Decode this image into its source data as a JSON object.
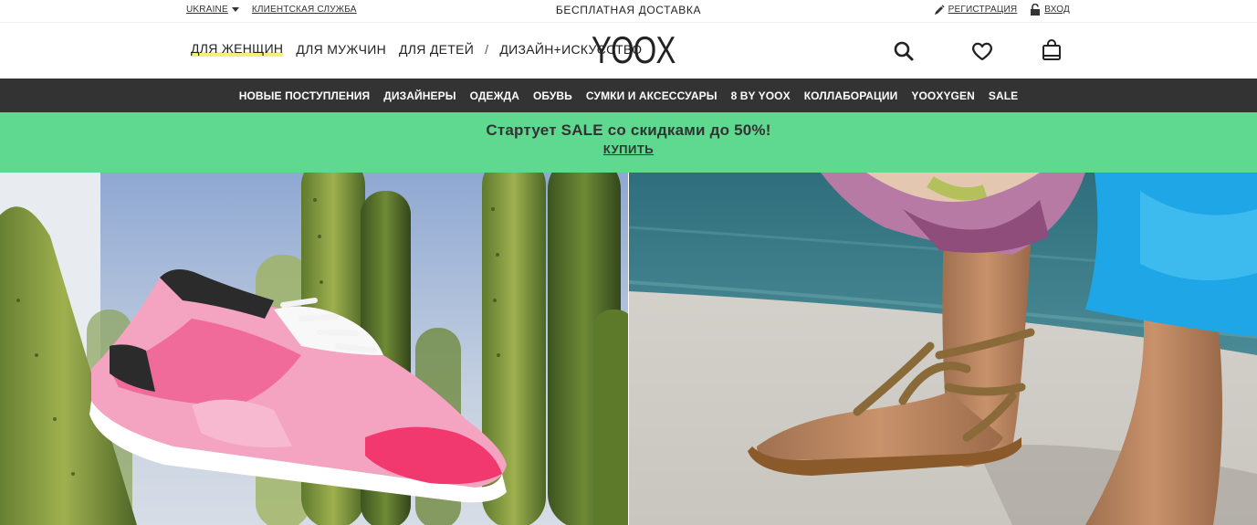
{
  "utility": {
    "country": "UKRAINE",
    "customer_service": "КЛИЕНТСКАЯ СЛУЖБА",
    "shipping": "БЕСПЛАТНАЯ ДОСТАВКА",
    "register": "РЕГИСТРАЦИЯ",
    "login": "ВХОД"
  },
  "header": {
    "nav": [
      "ДЛЯ ЖЕНЩИН",
      "ДЛЯ МУЖЧИН",
      "ДЛЯ ДЕТЕЙ"
    ],
    "separator": "/",
    "design_art": "ДИЗАЙН+ИСКУССТВО",
    "logo": "YOOX",
    "active_nav": "ДЛЯ ЖЕНЩИН",
    "icons": [
      "search-icon",
      "heart-icon",
      "shopping-bag-icon"
    ]
  },
  "categories": [
    "НОВЫЕ ПОСТУПЛЕНИЯ",
    "ДИЗАЙНЕРЫ",
    "ОДЕЖДА",
    "ОБУВЬ",
    "СУМКИ И АКСЕССУАРЫ",
    "8 BY YOOX",
    "КОЛЛАБОРАЦИИ",
    "YOOXYGEN",
    "SALE"
  ],
  "promo": {
    "title": "Стартует SALE со скидками до 50%!",
    "cta": "КУПИТЬ"
  },
  "colors": {
    "catbar_bg": "#333333",
    "promo_bg": "#5ed98f",
    "nav_highlight": "#f4ef7a"
  }
}
